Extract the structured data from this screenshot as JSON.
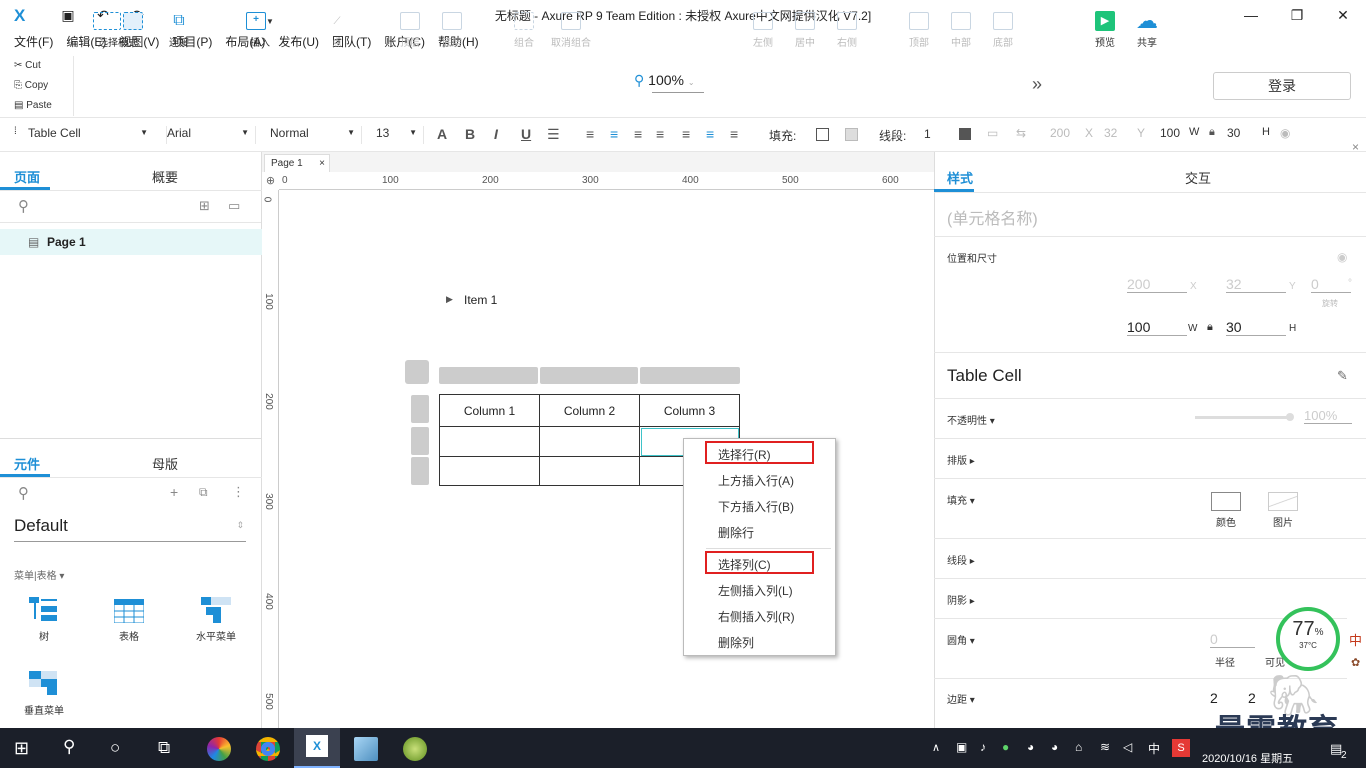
{
  "window": {
    "title": "无标题 - Axure RP 9 Team Edition : 未授权      Axure中文网提供汉化 V7.2]",
    "logo": "X",
    "controls": [
      "minimize",
      "maximize",
      "close"
    ]
  },
  "menubar": [
    "文件(F)",
    "编辑(E)",
    "视图(V)",
    "项目(P)",
    "布局(A)",
    "发布(U)",
    "团队(T)",
    "账户(C)",
    "帮助(H)"
  ],
  "clipboard": {
    "cut": "Cut",
    "copy": "Copy",
    "paste": "Paste"
  },
  "toolbar": {
    "select_mode": "选择模式",
    "connect": "连接",
    "insert": "插入",
    "point": "点",
    "top_layer": "顶层",
    "bottom_layer": "底层",
    "group": "组合",
    "ungroup": "取消组合",
    "zoom": "100%",
    "align_left": "左侧",
    "align_center": "居中",
    "align_right": "右侧",
    "align_top": "顶部",
    "align_middle": "中部",
    "align_bottom": "底部",
    "more": "»",
    "preview": "预览",
    "share": "共享",
    "login": "登录"
  },
  "formatbar": {
    "style": "Table Cell",
    "font": "Arial",
    "weight": "Normal",
    "size": "13",
    "fill_label": "填充:",
    "stroke_label": "线段:",
    "stroke_value": "1",
    "x": "200",
    "x_label": "X",
    "y": "32",
    "y_label": "Y",
    "w": "100",
    "w_label": "W",
    "h": "30",
    "h_label": "H"
  },
  "pages_panel": {
    "tabs": [
      "页面",
      "概要"
    ],
    "pages": [
      "Page 1"
    ]
  },
  "library_panel": {
    "tabs": [
      "元件",
      "母版"
    ],
    "library": "Default",
    "category": "菜单|表格 ▾",
    "widgets": [
      "树",
      "表格",
      "水平菜单",
      "垂直菜单"
    ]
  },
  "canvas": {
    "page_tab": "Page 1",
    "ruler_h": [
      "0",
      "100",
      "200",
      "300",
      "400",
      "500",
      "600"
    ],
    "ruler_v": [
      "0",
      "100",
      "200",
      "300",
      "400",
      "500"
    ],
    "tree_item": "Item 1",
    "table": {
      "headers": [
        "Column 1",
        "Column 2",
        "Column 3"
      ],
      "rows": [
        [
          "",
          "",
          ""
        ],
        [
          "",
          "",
          ""
        ]
      ]
    }
  },
  "context_menu": {
    "items": [
      "选择行(R)",
      "上方插入行(A)",
      "下方插入行(B)",
      "删除行",
      "选择列(C)",
      "左侧插入列(L)",
      "右侧插入列(R)",
      "删除列"
    ],
    "highlight_color": "#e02020"
  },
  "inspector": {
    "tabs": [
      "样式",
      "交互"
    ],
    "name_placeholder": "(单元格名称)",
    "position_size_label": "位置和尺寸",
    "x": "200",
    "x_label": "X",
    "y": "32",
    "y_label": "Y",
    "rotation": "0",
    "rotation_unit": "°",
    "rotation_label": "旋转",
    "w": "100",
    "w_label": "W",
    "h": "30",
    "h_label": "H",
    "style_name": "Table Cell",
    "opacity_label": "不透明性 ▾",
    "opacity_value": "100%",
    "typography_label": "排版 ▸",
    "fill_label": "填充 ▾",
    "fill_color": "颜色",
    "fill_image": "图片",
    "stroke_label": "线段 ▸",
    "shadow_label": "阴影 ▸",
    "corner_label": "圆角 ▾",
    "corner_radius": "0",
    "corner_radius_label": "半径",
    "corner_visible_label": "可见",
    "padding_label": "边距 ▾",
    "padding_left": "2",
    "padding_top": "2"
  },
  "overlay": {
    "gauge_percent": "77",
    "gauge_percent_unit": "%",
    "gauge_temp": "37°C",
    "watermark": "最需教育"
  },
  "taskbar": {
    "ime": "中",
    "datetime": "2020/10/16 星期五",
    "notification_count": "2",
    "accent": "#1b1f29"
  }
}
